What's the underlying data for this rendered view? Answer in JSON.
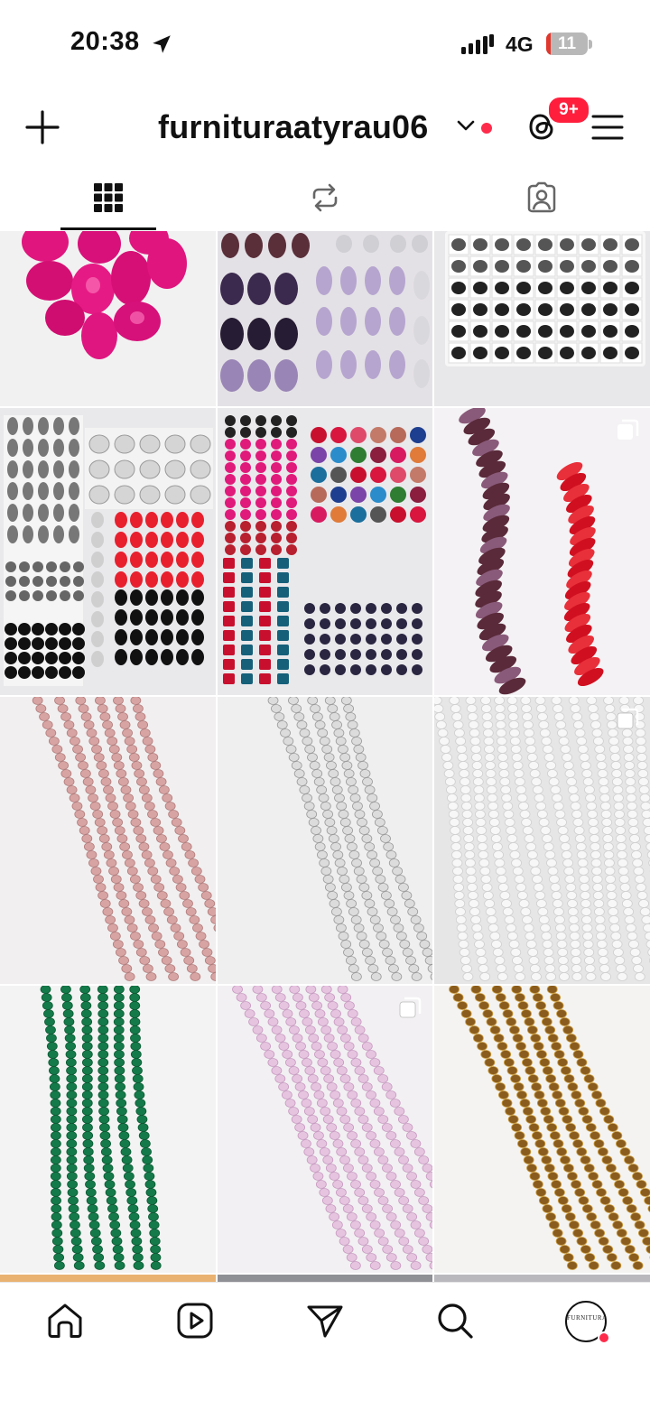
{
  "status_bar": {
    "time": "20:38",
    "network": "4G",
    "battery_level": "11",
    "battery_fraction": 0.11
  },
  "header": {
    "username": "furnituraatyrau06",
    "notification_badge": "9+"
  },
  "tabs": [
    {
      "name": "posts-grid"
    },
    {
      "name": "reels"
    },
    {
      "name": "tagged"
    }
  ],
  "colors": {
    "accent_red": "#ff2b4a",
    "text": "#111111"
  },
  "grid": {
    "posts": [
      {
        "subject": "pink rhinestones",
        "multi": false
      },
      {
        "subject": "purple rhinestones tray",
        "multi": false
      },
      {
        "subject": "black rhinestones tray",
        "multi": false
      },
      {
        "subject": "mixed rhinestones tray",
        "multi": false
      },
      {
        "subject": "colored rhinestones tray",
        "multi": false
      },
      {
        "subject": "drop bead strands",
        "multi": true
      },
      {
        "subject": "pink bead strands",
        "multi": false
      },
      {
        "subject": "clear bead strands",
        "multi": false
      },
      {
        "subject": "white bead strands",
        "multi": true
      },
      {
        "subject": "green bead strands",
        "multi": false
      },
      {
        "subject": "lilac bead strands",
        "multi": true
      },
      {
        "subject": "gold bead strands",
        "multi": false
      }
    ]
  },
  "profile_avatar_text": "FURNITURA"
}
